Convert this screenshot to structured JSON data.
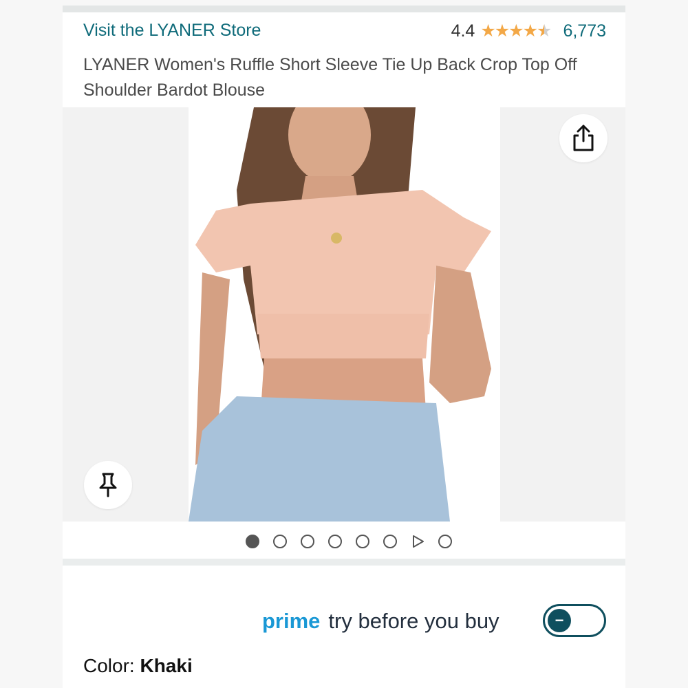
{
  "store": {
    "link_text": "Visit the LYANER Store"
  },
  "rating": {
    "value": "4.4",
    "stars": 4.4,
    "count": "6,773"
  },
  "product": {
    "title": "LYANER Women's Ruffle Short Sleeve Tie Up Back Crop Top Off Shoulder Bardot Blouse"
  },
  "gallery": {
    "dots": [
      {
        "type": "image",
        "active": true
      },
      {
        "type": "image",
        "active": false
      },
      {
        "type": "image",
        "active": false
      },
      {
        "type": "image",
        "active": false
      },
      {
        "type": "image",
        "active": false
      },
      {
        "type": "image",
        "active": false
      },
      {
        "type": "video",
        "active": false
      },
      {
        "type": "image",
        "active": false
      }
    ],
    "share_icon": "share-icon",
    "pin_icon": "pin-icon"
  },
  "prime": {
    "logo": "prime",
    "label": "try before you buy",
    "toggle_on": false
  },
  "color": {
    "label": "Color: ",
    "value": "Khaki"
  },
  "colors": {
    "link": "#0f6b7a",
    "star": "#f3a847",
    "prime": "#1a98d5",
    "toggle": "#0f4f5e"
  }
}
